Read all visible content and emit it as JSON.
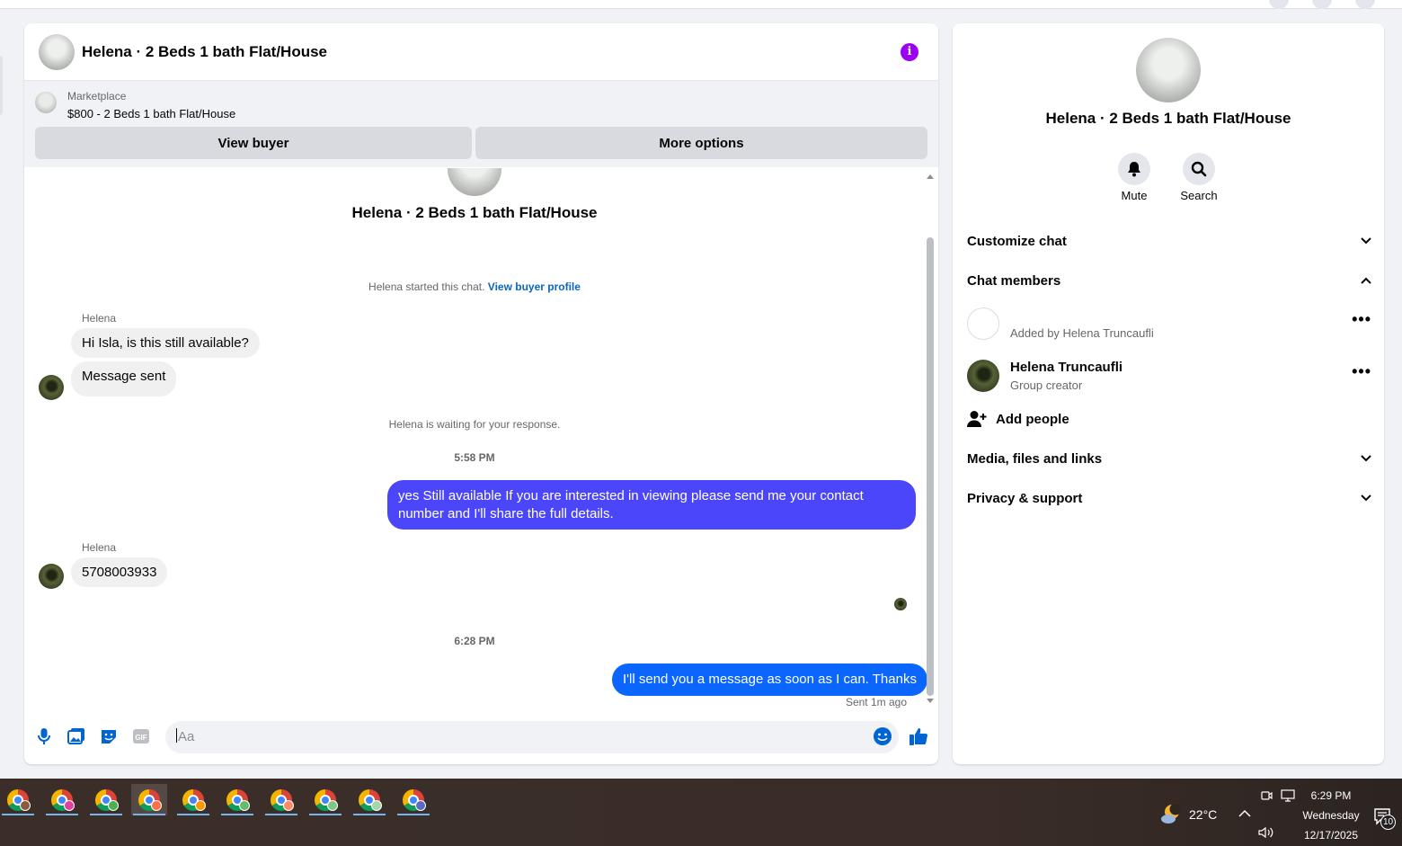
{
  "conversation": {
    "title": "Helena · 2 Beds 1 bath Flat/House"
  },
  "marketplace": {
    "label": "Marketplace",
    "product": "$800 - 2 Beds 1 bath Flat/House",
    "view_buyer": "View buyer",
    "more_options": "More options"
  },
  "messages": {
    "conv_title": "Helena · 2 Beds 1 bath Flat/House",
    "started_text": "Helena started this chat.",
    "view_profile": "View buyer profile",
    "sender1": "Helena",
    "msg1": "Hi Isla, is this still available?",
    "msg2": "Message sent",
    "waiting": "Helena is waiting for your response.",
    "time1": "5:58 PM",
    "out1": "yes Still available If you are interested in viewing please send me your contact number and I'll share the full details.",
    "sender2": "Helena",
    "msg3": "5708003933",
    "time2": "6:28 PM",
    "out2": "I'll send you a message as soon as I can. Thanks",
    "sent_status": "Sent 1m ago",
    "out1_color": "#4c46fb",
    "out2_color": "#0b66ff"
  },
  "composer": {
    "placeholder": "Aa"
  },
  "info_panel": {
    "name": "Helena · 2 Beds 1 bath Flat/House",
    "mute": "Mute",
    "search": "Search",
    "customize": "Customize chat",
    "members": "Chat members",
    "member1_sub": "Added by Helena Truncaufli",
    "member2_name": "Helena Truncaufli",
    "member2_sub": "Group creator",
    "add_people": "Add people",
    "media": "Media, files and links",
    "privacy": "Privacy & support"
  },
  "taskbar": {
    "temperature": "22°C",
    "time": "6:29 PM",
    "day": "Wednesday",
    "date": "12/17/2025",
    "notifications": "10",
    "accent": "#74b4f0"
  }
}
